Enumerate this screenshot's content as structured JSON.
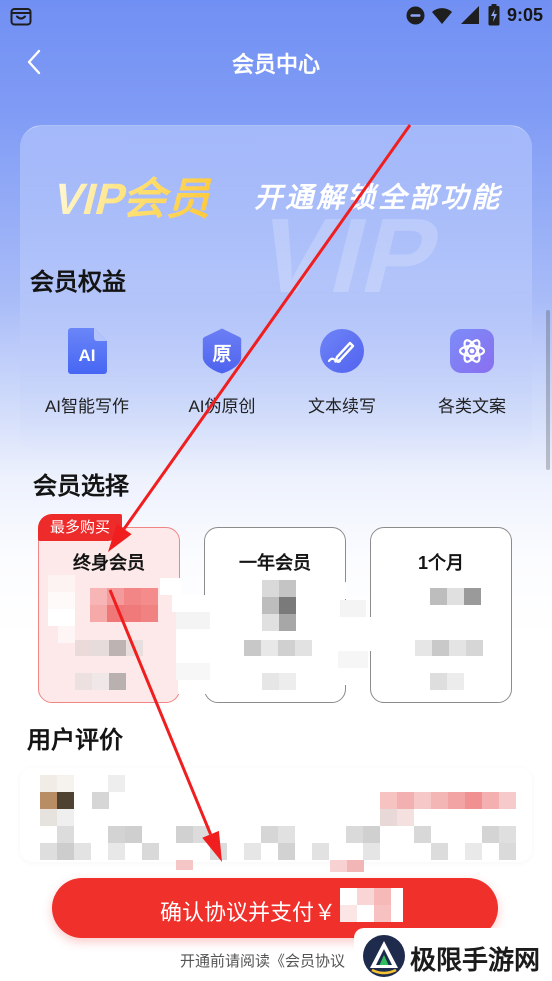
{
  "status_bar": {
    "time": "9:05",
    "icons": [
      "bag-icon",
      "do-not-disturb-icon",
      "wifi-icon",
      "signal-icon",
      "battery-charging-icon"
    ]
  },
  "header": {
    "back_icon": "chevron-left-icon",
    "title": "会员中心"
  },
  "banner": {
    "vip_title": "VIP会员",
    "subtitle": "开通解锁全部功能",
    "watermark": "VIP"
  },
  "benefits": {
    "heading": "会员权益",
    "items": [
      {
        "label": "AI智能写作",
        "icon": "ai-document-icon",
        "icon_text": "AI"
      },
      {
        "label": "AI伪原创",
        "icon": "original-badge-icon",
        "icon_text": "原"
      },
      {
        "label": "文本续写",
        "icon": "pen-circle-icon"
      },
      {
        "label": "各类文案",
        "icon": "atom-icon"
      }
    ]
  },
  "plans": {
    "heading": "会员选择",
    "badge": "最多购买",
    "items": [
      {
        "name": "终身会员",
        "selected": true
      },
      {
        "name": "一年会员",
        "selected": false
      },
      {
        "name": "1个月",
        "selected": false
      }
    ]
  },
  "reviews": {
    "heading": "用户评价"
  },
  "pay": {
    "button_label": "确认协议并支付￥",
    "notice_prefix": "开通前请阅读",
    "agreement_link": "《会员协议"
  },
  "watermark": {
    "text": "极限手游网"
  },
  "colors": {
    "header_blue": "#7190f3",
    "accent_red": "#f0302b",
    "icon_blue": "#5b6ff2",
    "vip_gold": "#ffd24a",
    "selected_plan_bg": "#fde9e9"
  }
}
